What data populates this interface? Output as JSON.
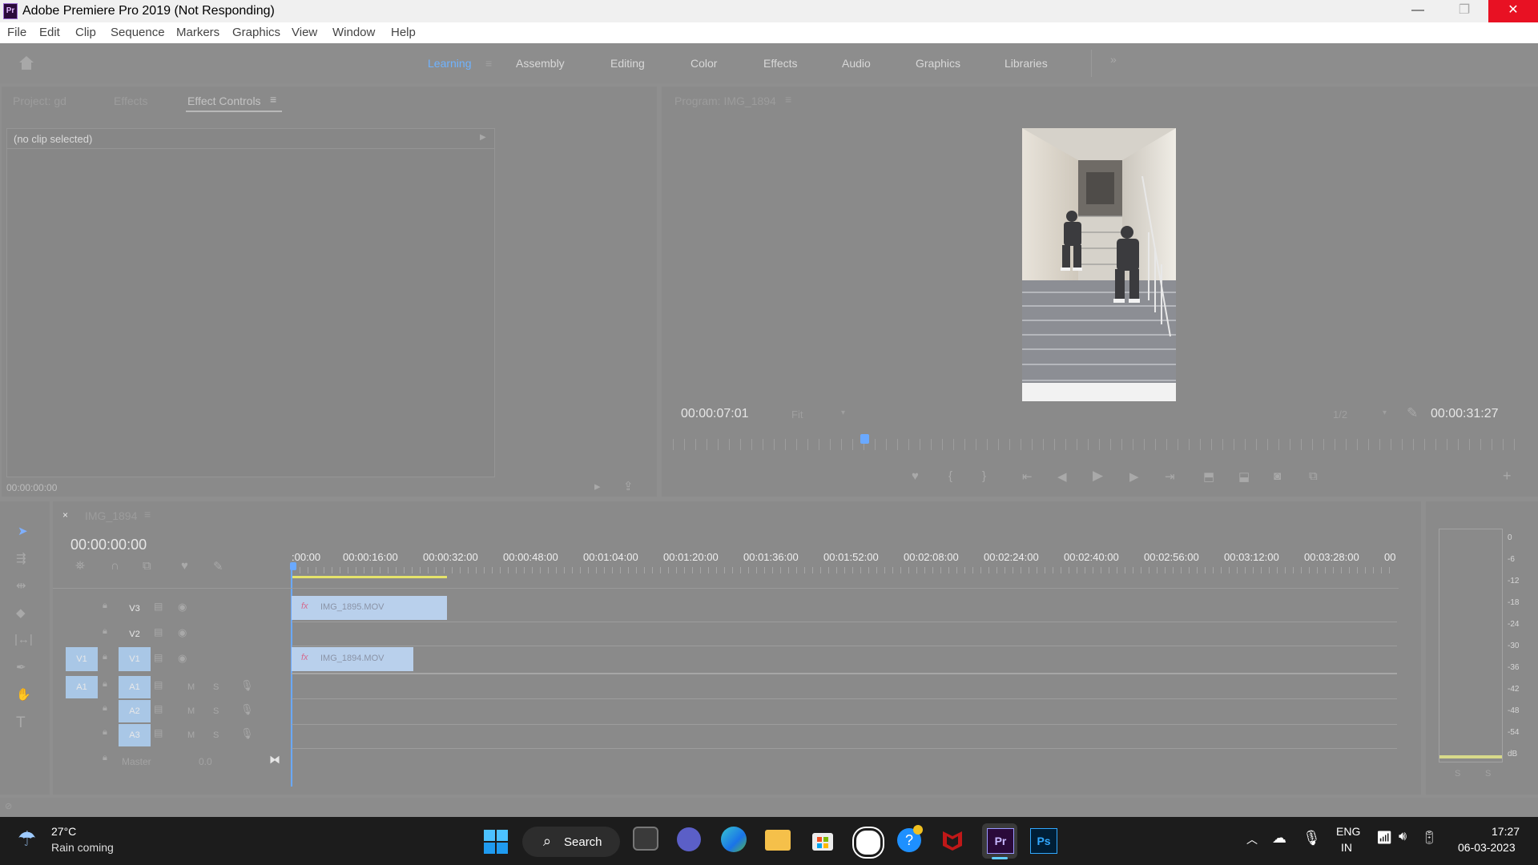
{
  "app": {
    "title": "Adobe Premiere Pro 2019 (Not Responding)",
    "logo": "Pr",
    "window_controls": {
      "minimize": "—",
      "restore": "❐",
      "close": "✕"
    }
  },
  "menu": [
    "File",
    "Edit",
    "Clip",
    "Sequence",
    "Markers",
    "Graphics",
    "View",
    "Window",
    "Help"
  ],
  "workspaces": {
    "items": [
      "Learning",
      "Assembly",
      "Editing",
      "Color",
      "Effects",
      "Audio",
      "Graphics",
      "Libraries"
    ],
    "active": "Learning",
    "more": "»"
  },
  "source_panel": {
    "tabs": [
      "Project: gd",
      "Effects",
      "Effect Controls"
    ],
    "active_tab": "Effect Controls",
    "no_clip": "(no clip selected)",
    "timecode": "00:00:00:00"
  },
  "program_monitor": {
    "title": "Program: IMG_1894",
    "current_time": "00:00:07:01",
    "fit": "Fit",
    "resolution": "1/2",
    "duration": "00:00:31:27",
    "playhead_fraction": 0.225
  },
  "timeline": {
    "sequence_name": "IMG_1894",
    "close": "×",
    "timecode": "00:00:00:00",
    "ruler": [
      ":00:00",
      "00:00:16:00",
      "00:00:32:00",
      "00:00:48:00",
      "00:01:04:00",
      "00:01:20:00",
      "00:01:36:00",
      "00:01:52:00",
      "00:02:08:00",
      "00:02:24:00",
      "00:02:40:00",
      "00:02:56:00",
      "00:03:12:00",
      "00:03:28:00",
      "00"
    ],
    "video_tracks": [
      "V3",
      "V2",
      "V1"
    ],
    "audio_tracks": [
      "A1",
      "A2",
      "A3"
    ],
    "source_patch": {
      "video": "V1",
      "audio": "A1"
    },
    "master": {
      "label": "Master",
      "value": "0.0"
    },
    "mute": "M",
    "solo": "S",
    "clips": [
      {
        "name": "IMG_1895.MOV",
        "track": "V3",
        "fx": "fx"
      },
      {
        "name": "IMG_1894.MOV",
        "track": "V1",
        "fx": "fx"
      }
    ]
  },
  "audio_meter": {
    "scale": [
      "0",
      "-6",
      "-12",
      "-18",
      "-24",
      "-30",
      "-36",
      "-42",
      "-48",
      "-54",
      "dB"
    ],
    "solo_labels": [
      "S",
      "S"
    ]
  },
  "taskbar": {
    "weather": {
      "temp": "27°C",
      "desc": "Rain coming"
    },
    "search": "Search",
    "lang": {
      "line1": "ENG",
      "line2": "IN"
    },
    "clock": {
      "time": "17:27",
      "date": "06-03-2023"
    },
    "pinned_icons": [
      "windows-start",
      "search",
      "task-view",
      "teams",
      "edge",
      "file-explorer",
      "microsoft-store",
      "steam-like",
      "help",
      "mcafee",
      "premiere-pro",
      "photoshop"
    ],
    "colors": {
      "premiere": "#9999ff",
      "photoshop": "#31a8ff"
    }
  }
}
